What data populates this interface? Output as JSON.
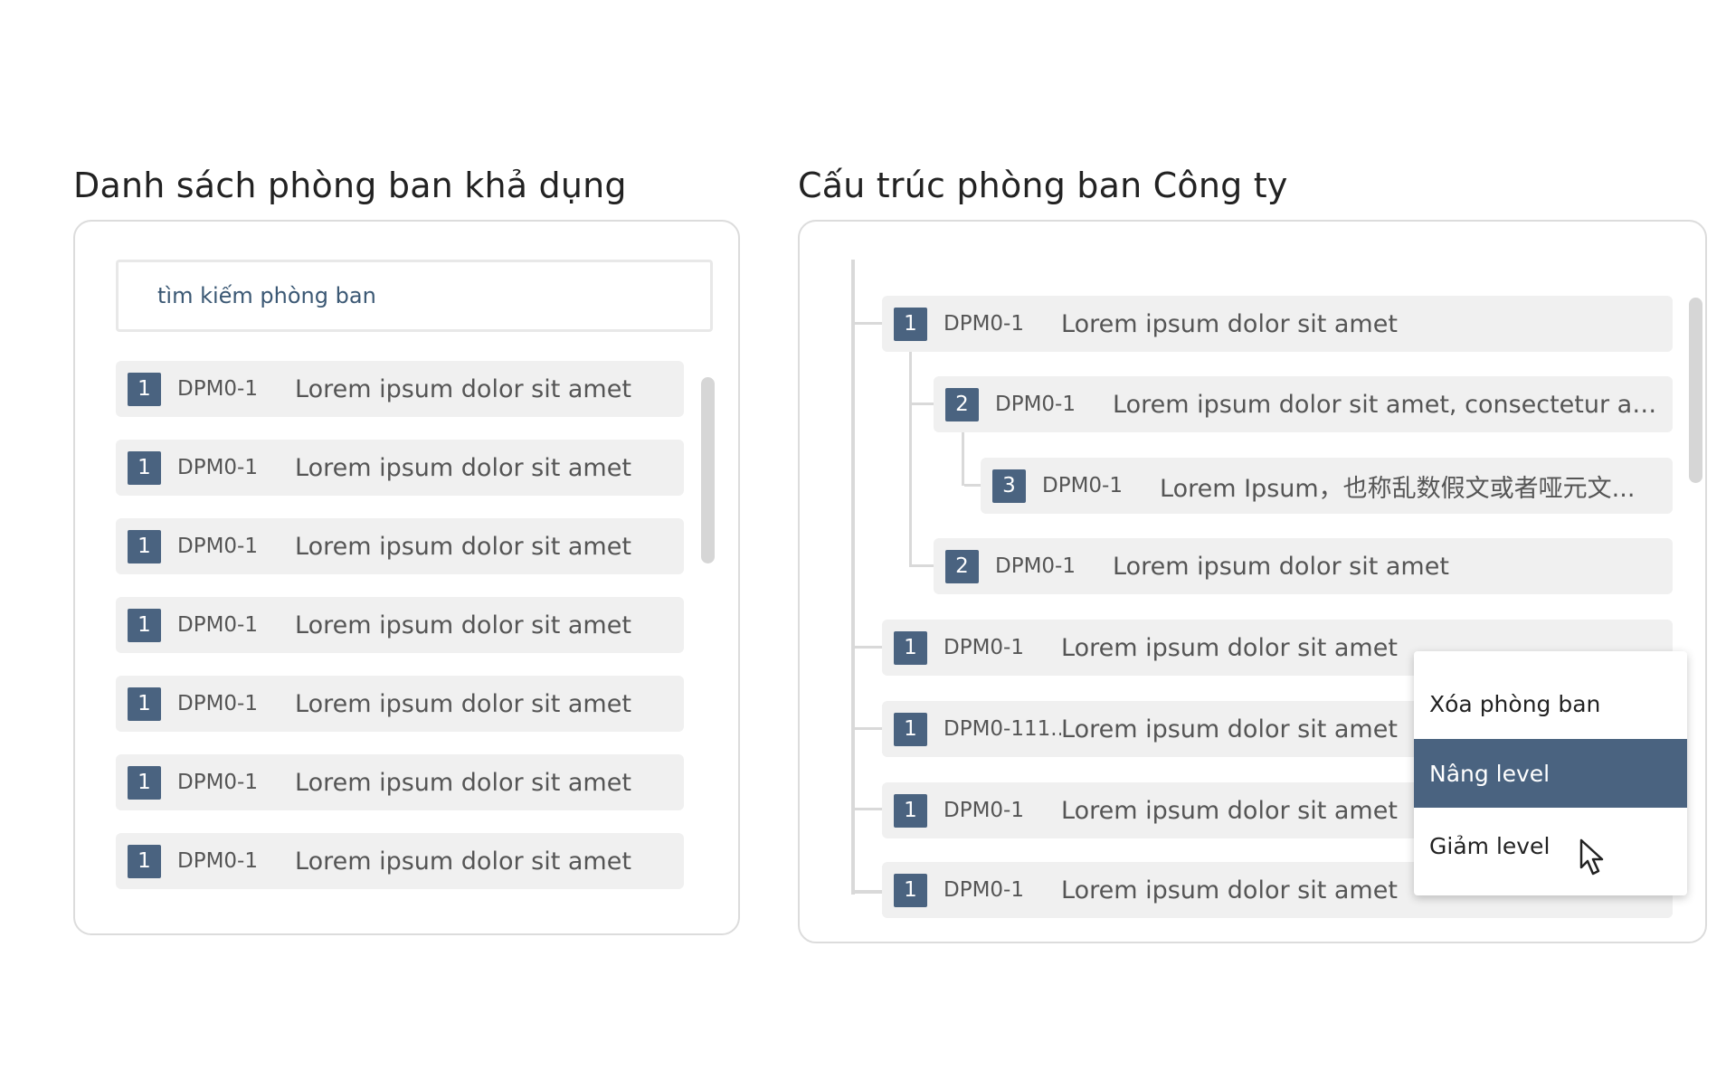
{
  "left": {
    "title": "Danh sách phòng ban khả dụng",
    "search_placeholder": "tìm kiếm phòng ban",
    "items": [
      {
        "level": "1",
        "code": "DPM0-1",
        "name": "Lorem ipsum dolor sit amet"
      },
      {
        "level": "1",
        "code": "DPM0-1",
        "name": "Lorem ipsum dolor sit amet"
      },
      {
        "level": "1",
        "code": "DPM0-1",
        "name": "Lorem ipsum dolor sit amet"
      },
      {
        "level": "1",
        "code": "DPM0-1",
        "name": "Lorem ipsum dolor sit amet"
      },
      {
        "level": "1",
        "code": "DPM0-1",
        "name": "Lorem ipsum dolor sit amet"
      },
      {
        "level": "1",
        "code": "DPM0-1",
        "name": "Lorem ipsum dolor sit amet"
      },
      {
        "level": "1",
        "code": "DPM0-1",
        "name": "Lorem ipsum dolor sit amet"
      }
    ]
  },
  "right": {
    "title": "Cấu trúc phòng ban Công ty",
    "tree": [
      {
        "level": "1",
        "code": "DPM0-1",
        "name": "Lorem ipsum dolor sit amet"
      },
      {
        "level": "2",
        "code": "DPM0-1",
        "name": "Lorem ipsum dolor sit amet, consectetur al..."
      },
      {
        "level": "3",
        "code": "DPM0-1",
        "name": "Lorem Ipsum，也称乱数假文或者哑元文..."
      },
      {
        "level": "2",
        "code": "DPM0-1",
        "name": "Lorem ipsum dolor sit amet"
      },
      {
        "level": "1",
        "code": "DPM0-1",
        "name": "Lorem ipsum dolor sit amet"
      },
      {
        "level": "1",
        "code": "DPM0-111..",
        "name": "Lorem ipsum dolor sit amet"
      },
      {
        "level": "1",
        "code": "DPM0-1",
        "name": "Lorem ipsum dolor sit amet"
      },
      {
        "level": "1",
        "code": "DPM0-1",
        "name": "Lorem ipsum dolor sit amet"
      }
    ]
  },
  "context_menu": {
    "items": [
      {
        "label": "Xóa phòng ban"
      },
      {
        "label": "Nâng level"
      },
      {
        "label": "Giảm level"
      }
    ],
    "highlighted": "Nâng level"
  },
  "colors": {
    "badge": "#4a6380",
    "row_bg": "#f0f0f0",
    "menu_highlight": "#4a6380",
    "search_text": "#3b5874"
  }
}
